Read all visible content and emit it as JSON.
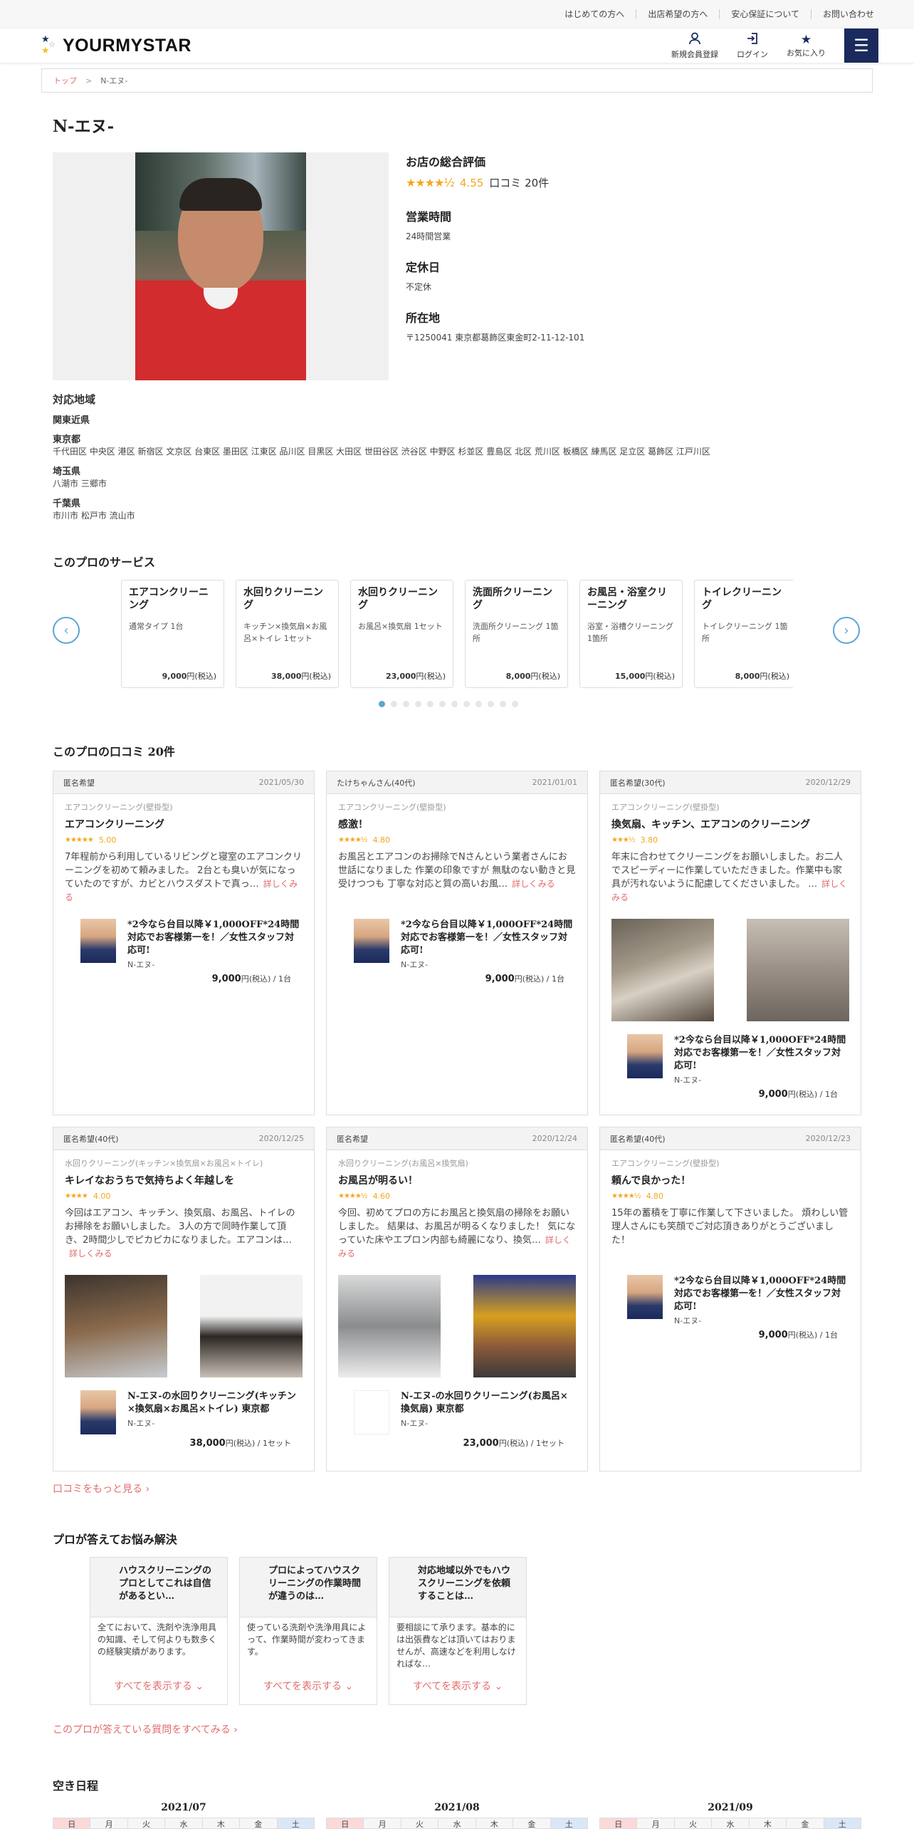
{
  "topbar": {
    "links": [
      "はじめての方へ",
      "出店希望の方へ",
      "安心保証について",
      "お問い合わせ"
    ]
  },
  "header": {
    "logo": "YOURMYSTAR",
    "nav": [
      {
        "label": "新規会員登録",
        "icon": "user-icon"
      },
      {
        "label": "ログイン",
        "icon": "login-icon"
      },
      {
        "label": "お気に入り",
        "icon": "star-icon"
      }
    ],
    "menu_icon": "hamburger-icon"
  },
  "breadcrumb": {
    "home": "トップ",
    "separator": ">",
    "current": "N-エヌ-"
  },
  "pro": {
    "name": "N-エヌ-",
    "rating_label": "お店の総合評価",
    "rating_value": "4.55",
    "review_count": "口コミ 20件",
    "hours_label": "営業時間",
    "hours": "24時間営業",
    "holiday_label": "定休日",
    "holiday": "不定休",
    "address_label": "所在地",
    "address": "〒1250041 東京都葛飾区東金町2-11-12-101"
  },
  "area": {
    "title": "対応地域",
    "region": "関東近県",
    "prefectures": [
      {
        "name": "東京都",
        "cities": "千代田区 中央区 港区 新宿区 文京区 台東区 墨田区 江東区 品川区 目黒区 大田区 世田谷区 渋谷区 中野区 杉並区 豊島区 北区 荒川区 板橋区 練馬区 足立区 葛飾区 江戸川区"
      },
      {
        "name": "埼玉県",
        "cities": "八潮市 三郷市"
      },
      {
        "name": "千葉県",
        "cities": "市川市 松戸市 流山市"
      }
    ]
  },
  "services": {
    "title": "このプロのサービス",
    "prev": "‹",
    "next": "›",
    "items": [
      {
        "name": "エアコンクリーニング",
        "desc": "通常タイプ 1台",
        "price": "9,000",
        "unit": "円(税込)"
      },
      {
        "name": "水回りクリーニング",
        "desc": "キッチン×換気扇×お風呂×トイレ 1セット",
        "price": "38,000",
        "unit": "円(税込)"
      },
      {
        "name": "水回りクリーニング",
        "desc": "お風呂×換気扇 1セット",
        "price": "23,000",
        "unit": "円(税込)"
      },
      {
        "name": "洗面所クリーニング",
        "desc": "洗面所クリーニング 1箇所",
        "price": "8,000",
        "unit": "円(税込)"
      },
      {
        "name": "お風呂・浴室クリーニング",
        "desc": "浴室・浴槽クリーニング 1箇所",
        "price": "15,000",
        "unit": "円(税込)"
      },
      {
        "name": "トイレクリーニング",
        "desc": "トイレクリーニング 1箇所",
        "price": "8,000",
        "unit": "円(税込)"
      }
    ],
    "dots_total": 12,
    "dots_active": 0
  },
  "reviews": {
    "title": "このプロの口コミ 20件",
    "more_label": "詳しくみる",
    "items": [
      {
        "user": "匿名希望",
        "date": "2021/05/30",
        "category": "エアコンクリーニング(壁掛型)",
        "title": "エアコンクリーニング",
        "stars": "★★★★★",
        "score": "5.00",
        "text": "7年程前から利用しているリビングと寝室のエアコンクリーニングを初めて頼みました。 2台とも臭いが気になっていたのですが、カビとハウスダストで真っ…",
        "photos": 0,
        "pro_title": "*2今なら台目以降￥1,000OFF*24時間対応でお客様第一を！／女性スタッフ対応可!",
        "pro_name": "N-エヌ-",
        "price": "9,000",
        "price_unit": "円(税込) / 1台"
      },
      {
        "user": "たけちゃんさん(40代)",
        "date": "2021/01/01",
        "category": "エアコンクリーニング(壁掛型)",
        "title": "感激！",
        "stars": "★★★★½",
        "score": "4.80",
        "text": "お風呂とエアコンのお掃除でNさんという業者さんにお世話になりました 作業の印象ですが 無駄のない動きと見受けつつも 丁寧な対応と質の高いお風…",
        "photos": 0,
        "pro_title": "*2今なら台目以降￥1,000OFF*24時間対応でお客様第一を！／女性スタッフ対応可!",
        "pro_name": "N-エヌ-",
        "price": "9,000",
        "price_unit": "円(税込) / 1台"
      },
      {
        "user": "匿名希望(30代)",
        "date": "2020/12/29",
        "category": "エアコンクリーニング(壁掛型)",
        "title": "換気扇、キッチン、エアコンのクリーニング",
        "stars": "★★★½",
        "score": "3.80",
        "text": "年末に合わせてクリーニングをお願いしました。お二人でスピーディーに作業していただきました。作業中も家具が汚れないように配慮してくださいました。 …",
        "photos": 2,
        "pro_title": "*2今なら台目以降￥1,000OFF*24時間対応でお客様第一を！／女性スタッフ対応可!",
        "pro_name": "N-エヌ-",
        "price": "9,000",
        "price_unit": "円(税込) / 1台"
      },
      {
        "user": "匿名希望(40代)",
        "date": "2020/12/25",
        "category": "水回りクリーニング(キッチン×換気扇×お風呂×トイレ)",
        "title": "キレイなおうちで気持ちよく年越しを",
        "stars": "★★★★",
        "score": "4.00",
        "text": "今回はエアコン、キッチン、換気扇、お風呂、トイレのお掃除をお願いしました。 3人の方で同時作業して頂き、2時間少しでピカピカになりました。エアコンは…",
        "photos": 2,
        "pro_title": "N-エヌ-の水回りクリーニング(キッチン×換気扇×お風呂×トイレ) 東京都",
        "pro_name": "N-エヌ-",
        "price": "38,000",
        "price_unit": "円(税込) / 1セット"
      },
      {
        "user": "匿名希望",
        "date": "2020/12/24",
        "category": "水回りクリーニング(お風呂×換気扇)",
        "title": "お風呂が明るい！",
        "stars": "★★★★½",
        "score": "4.60",
        "text": "今回、初めてプロの方にお風呂と換気扇の掃除をお願いしました。 結果は、お風呂が明るくなりました！ 気になっていた床やエプロン内部も綺麗になり、換気…",
        "photos": 2,
        "pro_title": "N-エヌ-の水回りクリーニング(お風呂×換気扇) 東京都",
        "pro_name": "N-エヌ-",
        "price": "23,000",
        "price_unit": "円(税込) / 1セット"
      },
      {
        "user": "匿名希望(40代)",
        "date": "2020/12/23",
        "category": "エアコンクリーニング(壁掛型)",
        "title": "頼んで良かった！",
        "stars": "★★★★½",
        "score": "4.80",
        "text": "15年の蓄積を丁寧に作業して下さいました。 煩わしい管理人さんにも笑顔でご対応頂きありがとうございました！",
        "photos": 0,
        "pro_title": "*2今なら台目以降￥1,000OFF*24時間対応でお客様第一を！／女性スタッフ対応可!",
        "pro_name": "N-エヌ-",
        "price": "9,000",
        "price_unit": "円(税込) / 1台"
      }
    ],
    "see_more": "口コミをもっと見る ›"
  },
  "faq": {
    "title": "プロが答えてお悩み解決",
    "show_all": "すべてを表示する ⌄",
    "items": [
      {
        "q": "ハウスクリーニングのプロとしてこれは自信があるとい…",
        "a": "全てにおいて、洗剤や洗浄用具の知識、そして何よりも数多くの経験実績があります。"
      },
      {
        "q": "プロによってハウスクリーニングの作業時間が違うのは…",
        "a": "使っている洗剤や洗浄用具によって、作業時間が変わってきます。"
      },
      {
        "q": "対応地域以外でもハウスクリーニングを依頼することは…",
        "a": "要相談にて承ります。基本的には出張費などは頂いてはおりませんが、高速などを利用しなければな…"
      }
    ],
    "all_questions": "このプロが答えている質問をすべてみる ›"
  },
  "schedule": {
    "title": "空き日程",
    "months": [
      "2021/07",
      "2021/08",
      "2021/09"
    ],
    "weekdays": [
      "日",
      "月",
      "火",
      "水",
      "木",
      "金",
      "土"
    ]
  }
}
